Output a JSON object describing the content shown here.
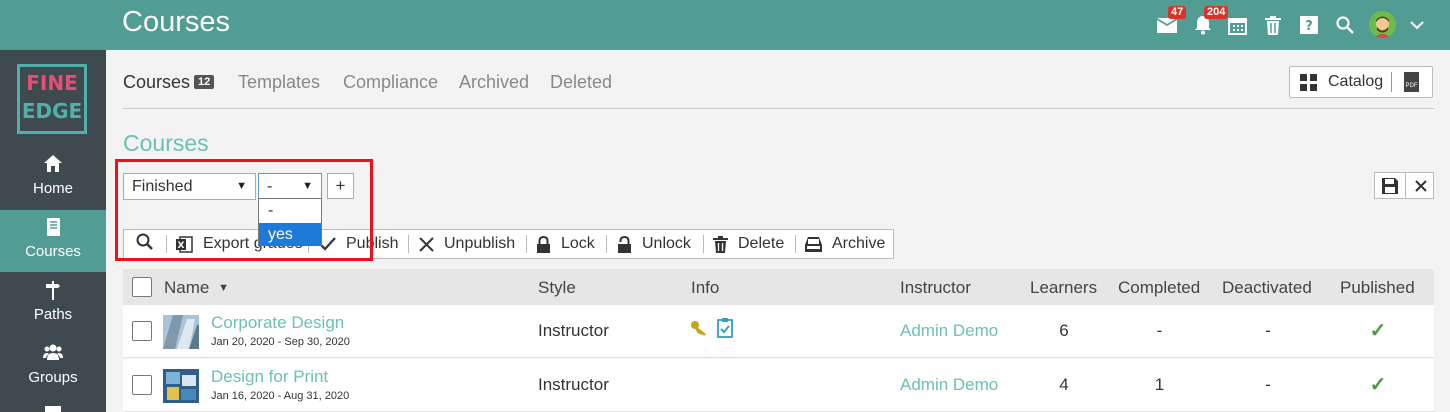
{
  "header": {
    "title": "Courses",
    "messages_badge": "47",
    "notifications_badge": "204"
  },
  "logo": {
    "line1": "FINE",
    "line2": "EDGE"
  },
  "sidebar": {
    "items": [
      {
        "label": "Home",
        "icon": "home-icon"
      },
      {
        "label": "Courses",
        "icon": "book-icon",
        "active": true
      },
      {
        "label": "Paths",
        "icon": "signpost-icon"
      },
      {
        "label": "Groups",
        "icon": "users-icon"
      }
    ]
  },
  "tabs": [
    {
      "label": "Courses",
      "count": "12",
      "active": true
    },
    {
      "label": "Templates"
    },
    {
      "label": "Compliance"
    },
    {
      "label": "Archived"
    },
    {
      "label": "Deleted"
    }
  ],
  "catalog": {
    "label": "Catalog",
    "pdf": "PDF"
  },
  "section_title": "Courses",
  "filter": {
    "field": "Finished",
    "value": "-",
    "add": "+",
    "options": [
      "-",
      "yes"
    ],
    "highlighted_option": "yes"
  },
  "toolbar": {
    "export": "Export grades",
    "publish": "Publish",
    "unpublish": "Unpublish",
    "lock": "Lock",
    "unlock": "Unlock",
    "delete": "Delete",
    "archive": "Archive"
  },
  "table": {
    "headers": {
      "name": "Name",
      "style": "Style",
      "info": "Info",
      "instructor": "Instructor",
      "learners": "Learners",
      "completed": "Completed",
      "deactivated": "Deactivated",
      "published": "Published"
    },
    "rows": [
      {
        "name": "Corporate Design",
        "dates": "Jan 20, 2020 - Sep 30, 2020",
        "style": "Instructor",
        "instructor": "Admin Demo",
        "learners": "6",
        "completed": "-",
        "deactivated": "-",
        "published": "✓"
      },
      {
        "name": "Design for Print",
        "dates": "Jan 16, 2020 - Aug 31, 2020",
        "style": "Instructor",
        "instructor": "Admin Demo",
        "learners": "4",
        "completed": "1",
        "deactivated": "-",
        "published": "✓"
      }
    ]
  },
  "colors": {
    "topbar": "#519c93",
    "sidebar": "#3f4a4e",
    "accent": "#6cc0b6",
    "highlight_box": "#e8131b"
  }
}
